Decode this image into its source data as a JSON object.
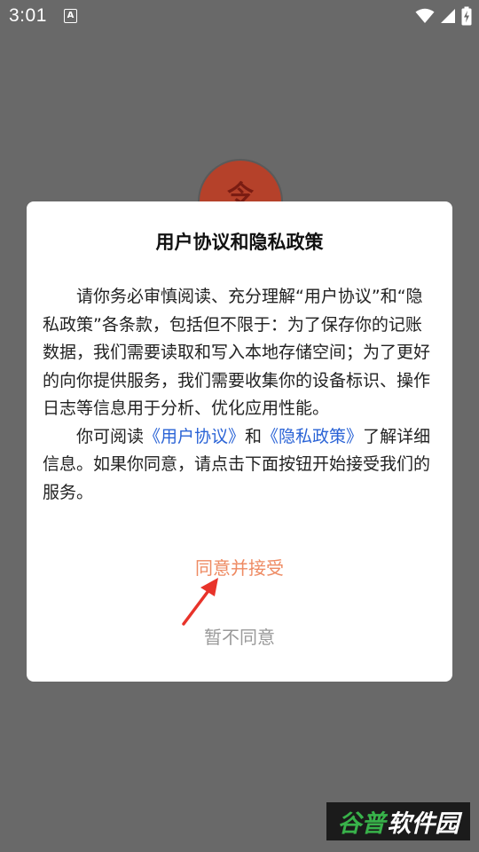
{
  "status_bar": {
    "time": "3:01",
    "notification_icon_letter": "A",
    "icons": [
      "wifi-icon",
      "cellular-signal-icon",
      "battery-charging-icon"
    ]
  },
  "app_logo": {
    "glyph": "令",
    "color": "#b5412a"
  },
  "dialog": {
    "title": "用户协议和隐私政策",
    "paragraph1": "请你务必审慎阅读、充分理解“用户协议”和“隐私政策”各条款，包括但不限于：为了保存你的记账数据，我们需要读取和写入本地存储空间；为了更好的向你提供服务，我们需要收集你的设备标识、操作日志等信息用于分析、优化应用性能。",
    "paragraph2": {
      "prefix": "你可阅读",
      "user_agreement_link": "《用户协议》",
      "middle": "和",
      "privacy_policy_link": "《隐私政策》",
      "suffix": "了解详细信息。如果你同意，请点击下面按钮开始接受我们的服务。"
    },
    "accept_label": "同意并接受",
    "decline_label": "暂不同意"
  },
  "colors": {
    "overlay_background": "#696969",
    "accept_text": "#ee8a62",
    "decline_text": "#9a9a9a",
    "link": "#2a63d6",
    "annotation_arrow": "#e8332a"
  },
  "watermark": {
    "part1": "谷普",
    "part2": "软件园"
  }
}
